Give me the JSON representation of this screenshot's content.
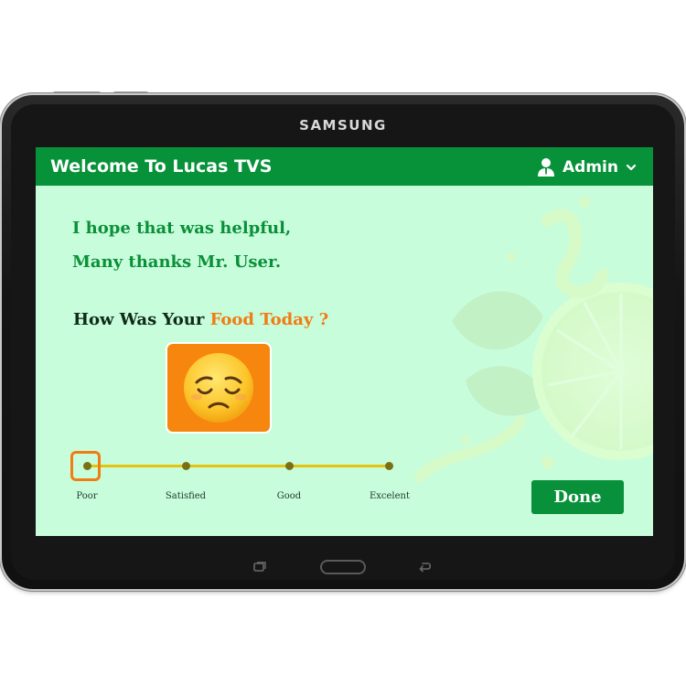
{
  "device": {
    "brand": "SAMSUNG"
  },
  "app": {
    "title": "Welcome To Lucas TVS"
  },
  "header": {
    "user": {
      "name": "Admin",
      "icon": "user-icon",
      "dropdown_icon": "chevron-down-icon"
    }
  },
  "message": {
    "line1": "I hope that was helpful,",
    "line2": "Many thanks Mr. User."
  },
  "question": {
    "prefix": "How Was Your ",
    "highlight": "Food Today ?"
  },
  "rating": {
    "selected": "Poor",
    "selected_emoji": "sad-face-emoji",
    "options": [
      "Poor",
      "Satisfied",
      "Good",
      "Excelent"
    ]
  },
  "actions": {
    "done_label": "Done"
  },
  "colors": {
    "primary": "#07923a",
    "accent": "#f07c12",
    "screen_bg": "#c8fddc",
    "track": "#e4c30c"
  }
}
